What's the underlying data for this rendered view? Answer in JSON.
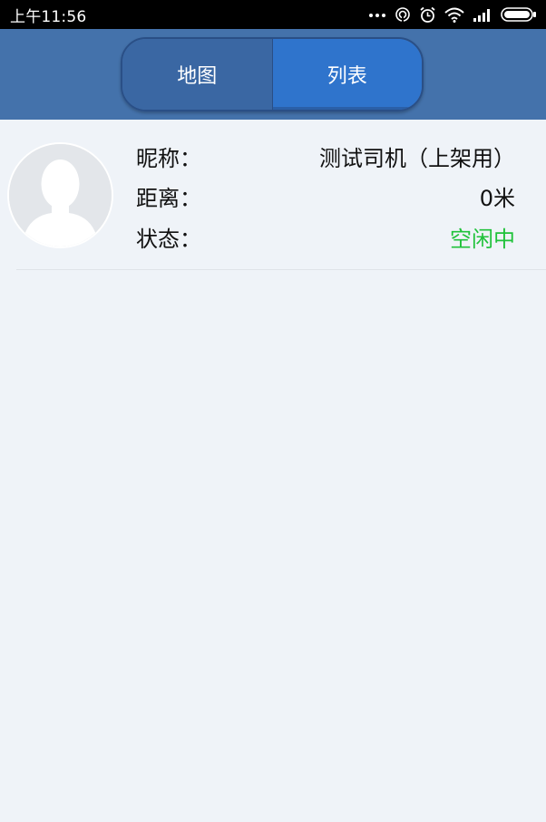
{
  "status_bar": {
    "time": "上午11:56",
    "icons": [
      "more-dots-icon",
      "hotspot-icon",
      "alarm-icon",
      "wifi-icon",
      "signal-icon",
      "battery-icon"
    ]
  },
  "tabs": [
    {
      "label": "地图",
      "active": false
    },
    {
      "label": "列表",
      "active": true
    }
  ],
  "drivers": [
    {
      "nickname_label": "昵称：",
      "nickname": "测试司机（上架用）",
      "distance_label": "距离：",
      "distance": "0米",
      "status_label": "状态：",
      "status": "空闲中"
    }
  ],
  "colors": {
    "header": "#4472ab",
    "active_tab": "#2f74cc",
    "inactive_tab": "#3a67a3",
    "status_idle": "#1fc23a",
    "background": "#eff3f8"
  }
}
